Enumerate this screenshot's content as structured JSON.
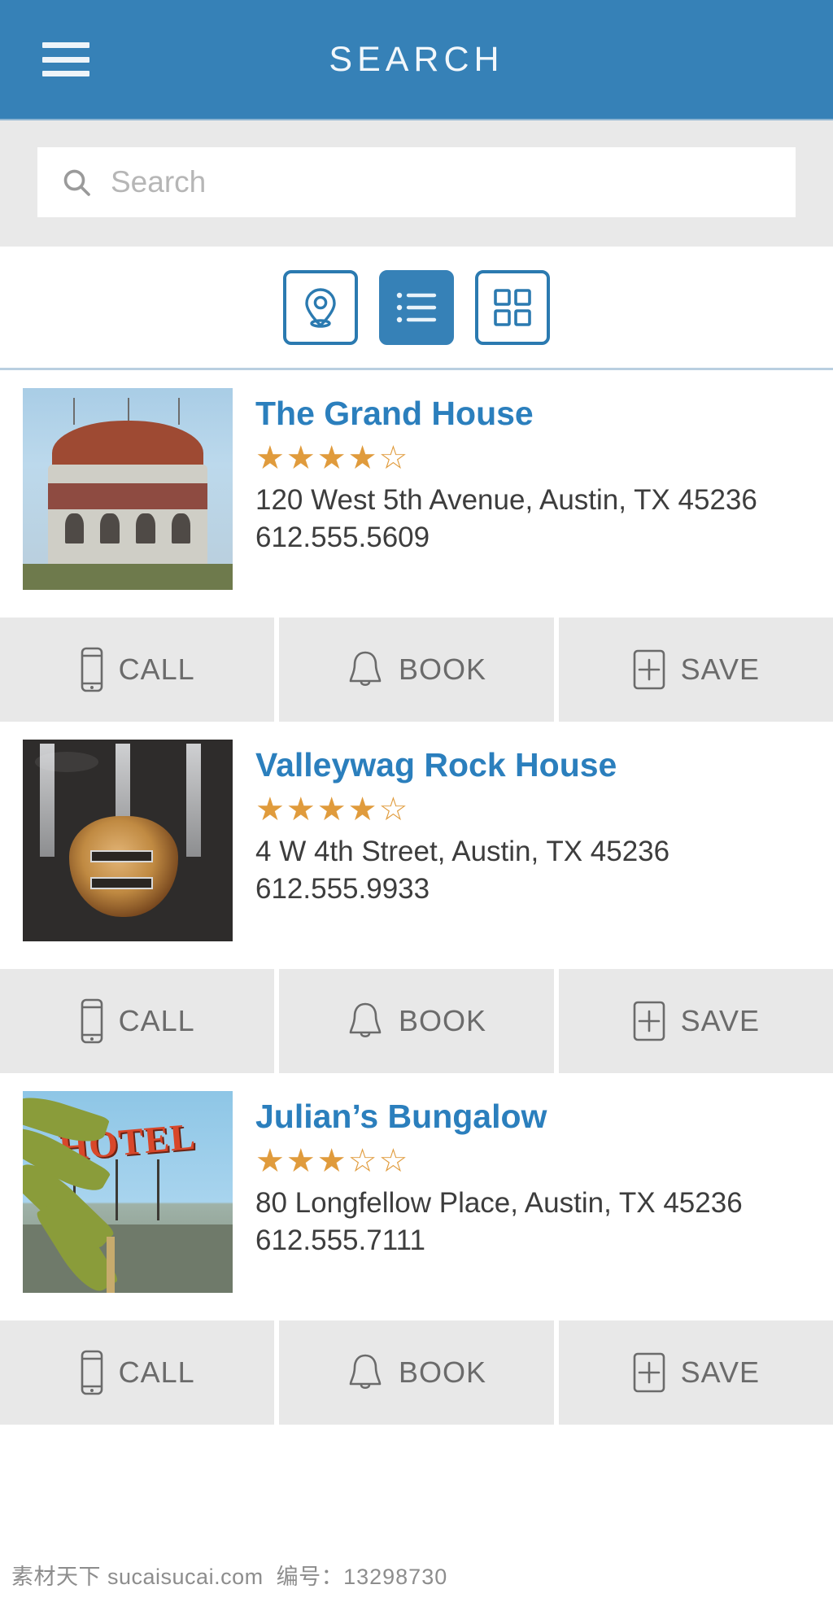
{
  "header": {
    "title": "SEARCH",
    "menu_icon": "hamburger-menu-icon",
    "background_color": "#3681b7"
  },
  "search": {
    "placeholder": "Search",
    "value": "",
    "icon": "search-icon"
  },
  "view_toggles": {
    "active": "list",
    "items": [
      {
        "id": "map",
        "icon": "map-pin-icon",
        "active": false
      },
      {
        "id": "list",
        "icon": "list-view-icon",
        "active": true
      },
      {
        "id": "grid",
        "icon": "grid-view-icon",
        "active": false
      }
    ]
  },
  "action_labels": {
    "call": "CALL",
    "book": "BOOK",
    "save": "SAVE",
    "call_icon": "phone-icon",
    "book_icon": "bell-icon",
    "save_icon": "plus-square-icon"
  },
  "listings": [
    {
      "title": "The Grand House",
      "rating": 4,
      "rating_max": 5,
      "stars": "★★★★☆",
      "address": "120 West 5th Avenue, Austin, TX 45236",
      "phone": "612.555.5609",
      "thumb": "historic-building-photo"
    },
    {
      "title": "Valleywag Rock House",
      "rating": 4,
      "rating_max": 5,
      "stars": "★★★★☆",
      "address": "4 W 4th Street, Austin, TX 45236",
      "phone": "612.555.9933",
      "thumb": "guitars-photo"
    },
    {
      "title": "Julian’s Bungalow",
      "rating": 3,
      "rating_max": 5,
      "stars": "★★★☆☆",
      "address": "80 Longfellow Place, Austin, TX 45236",
      "phone": "612.555.7111",
      "thumb": "hotel-sign-photo"
    }
  ],
  "watermark": {
    "site": "素材天下 sucaisucai.com",
    "id_label": "编号：",
    "id_value": "13298730"
  },
  "colors": {
    "brand_blue": "#3681b7",
    "title_blue": "#2b7fbd",
    "star_gold": "#e09b3c",
    "action_bg": "#e8e8e8",
    "search_bg": "#e9e9e9"
  },
  "hotel_sign_text": "HOTEL"
}
